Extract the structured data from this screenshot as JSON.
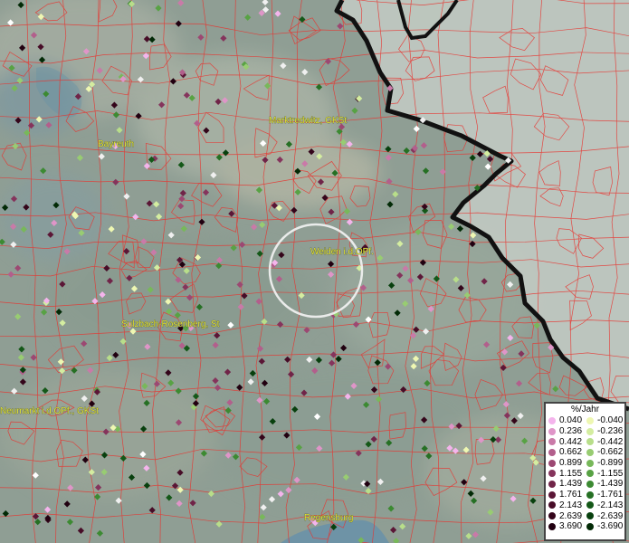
{
  "map": {
    "cities": [
      {
        "name": "Bayreuth"
      },
      {
        "name": "Marktredwitz, GKSt"
      },
      {
        "name": "Weiden i.d.OPf."
      },
      {
        "name": "Sulzbach-Rosenberg, St"
      },
      {
        "name": "Neumarkt i.d.OPf., GKSt"
      },
      {
        "name": "Regensburg"
      }
    ]
  },
  "legend": {
    "title": "%/Jahr",
    "positive": [
      {
        "label": "0.040",
        "color": "#f4b4ec"
      },
      {
        "label": "0.236",
        "color": "#df95c8"
      },
      {
        "label": "0.442",
        "color": "#c97aa8"
      },
      {
        "label": "0.662",
        "color": "#b25f8c"
      },
      {
        "label": "0.899",
        "color": "#9c4872"
      },
      {
        "label": "1.155",
        "color": "#85345c"
      },
      {
        "label": "1.439",
        "color": "#702448"
      },
      {
        "label": "1.761",
        "color": "#5b1636"
      },
      {
        "label": "2.143",
        "color": "#470c27"
      },
      {
        "label": "2.639",
        "color": "#34051a"
      },
      {
        "label": "3.690",
        "color": "#210010"
      }
    ],
    "negative": [
      {
        "label": "-0.040",
        "color": "#eef7b2"
      },
      {
        "label": "-0.236",
        "color": "#d4eda0"
      },
      {
        "label": "-0.442",
        "color": "#b8de8a"
      },
      {
        "label": "-0.662",
        "color": "#98cc72"
      },
      {
        "label": "-0.899",
        "color": "#78b85a"
      },
      {
        "label": "-1.155",
        "color": "#58a244"
      },
      {
        "label": "-1.439",
        "color": "#3c8a32"
      },
      {
        "label": "-1.761",
        "color": "#267024"
      },
      {
        "label": "-2.143",
        "color": "#145818"
      },
      {
        "label": "-2.639",
        "color": "#08400e"
      },
      {
        "label": "-3.690",
        "color": "#022a06"
      }
    ]
  },
  "colors": {
    "background": "#8f9e94",
    "border_lines": "#e8332e",
    "country_border": "#111111",
    "foreign_area": "#c3cbc4",
    "label_yellow": "#e2e23a"
  }
}
